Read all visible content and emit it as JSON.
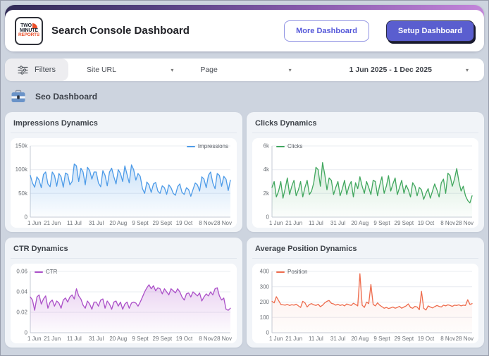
{
  "header": {
    "logo": {
      "line1": "TWO",
      "line2": "MINUTE",
      "line3": "REPORTS"
    },
    "title": "Search Console Dashboard",
    "buttons": {
      "more": "More Dashboard",
      "setup": "Setup Dashboard"
    }
  },
  "colors": {
    "accent": "#5a5ecf",
    "brand_orange": "#e94f2a",
    "header_gradient": [
      "#312b56",
      "#53407f",
      "#8a5cae",
      "#c385da"
    ]
  },
  "filter_bar": {
    "filters_label": "Filters",
    "site_url_label": "Site URL",
    "page_label": "Page",
    "date_range": "1 Jun 2025 - 1 Dec 2025",
    "caret": "▾"
  },
  "section": {
    "title": "Seo Dashboard"
  },
  "chart_data": [
    {
      "id": "impressions",
      "title": "Impressions Dynamics",
      "type": "area",
      "legend": {
        "label": "Impressions",
        "position": "right"
      },
      "color": "#4d9be8",
      "fill_opacity": 0.3,
      "ymax": 150000,
      "y_ticks": [
        {
          "v": 0,
          "label": "0"
        },
        {
          "v": 50000,
          "label": "50k"
        },
        {
          "v": 100000,
          "label": "100k"
        },
        {
          "v": 150000,
          "label": "150k"
        }
      ],
      "x_labels": [
        "1 Jun",
        "21 Jun",
        "11 Jul",
        "31 Jul",
        "20 Aug",
        "9 Sept",
        "29 Sept",
        "19 Oct",
        "8 Nov",
        "28 Nov"
      ],
      "x_label_step": 10,
      "values": [
        88000,
        72000,
        63000,
        85000,
        78000,
        62000,
        90000,
        95000,
        70000,
        64000,
        95000,
        88000,
        65000,
        92000,
        85000,
        63000,
        93000,
        90000,
        68000,
        75000,
        112000,
        108000,
        75000,
        103000,
        95000,
        68000,
        105000,
        98000,
        80000,
        95000,
        95000,
        72000,
        64000,
        98000,
        88000,
        66000,
        95000,
        103000,
        85000,
        70000,
        100000,
        92000,
        75000,
        108000,
        90000,
        72000,
        110000,
        100000,
        78000,
        92000,
        86000,
        60000,
        50000,
        74000,
        68000,
        52000,
        70000,
        73000,
        55000,
        50000,
        66000,
        62000,
        48000,
        68000,
        62000,
        50000,
        46000,
        64000,
        70000,
        52000,
        48000,
        62000,
        58000,
        44000,
        58000,
        72000,
        68000,
        55000,
        85000,
        80000,
        62000,
        88000,
        95000,
        72000,
        60000,
        92000,
        88000,
        65000,
        86000,
        80000,
        56000,
        78000
      ]
    },
    {
      "id": "clicks",
      "title": "Clicks Dynamics",
      "type": "area",
      "legend": {
        "label": "Clicks",
        "position": "left"
      },
      "color": "#41a75e",
      "fill_opacity": 0.22,
      "ymax": 6000,
      "y_ticks": [
        {
          "v": 0,
          "label": "0"
        },
        {
          "v": 2000,
          "label": "2k"
        },
        {
          "v": 4000,
          "label": "4k"
        },
        {
          "v": 6000,
          "label": "6k"
        }
      ],
      "x_labels": [
        "1 Jun",
        "21 Jun",
        "11 Jul",
        "31 Jul",
        "20 Aug",
        "9 Sept",
        "29 Sept",
        "19 Oct",
        "8 Nov",
        "28 Nov"
      ],
      "x_label_step": 10,
      "values": [
        2500,
        3000,
        1700,
        2200,
        3000,
        1600,
        2400,
        3300,
        1900,
        2600,
        3100,
        1800,
        2300,
        3000,
        1700,
        2500,
        3100,
        1900,
        2200,
        2900,
        4200,
        4000,
        2600,
        4600,
        3600,
        2300,
        3300,
        3100,
        1900,
        2500,
        3000,
        1800,
        2400,
        3100,
        1900,
        2600,
        3000,
        1700,
        2900,
        2400,
        3400,
        2600,
        2000,
        3000,
        2500,
        1900,
        3100,
        3000,
        1800,
        2700,
        3400,
        2000,
        2600,
        3500,
        2200,
        2800,
        3300,
        1900,
        2500,
        3100,
        2000,
        2700,
        2300,
        1700,
        2900,
        2600,
        1800,
        2500,
        2300,
        1500,
        2000,
        2400,
        1600,
        2200,
        2800,
        2300,
        1700,
        2900,
        3200,
        2000,
        3700,
        3500,
        2600,
        3200,
        4100,
        3000,
        2200,
        2600,
        1800,
        1400,
        1200,
        1800
      ]
    },
    {
      "id": "ctr",
      "title": "CTR Dynamics",
      "type": "area",
      "legend": {
        "label": "CTR",
        "position": "left"
      },
      "color": "#ab4fc8",
      "fill_opacity": 0.25,
      "ymax": 0.06,
      "y_ticks": [
        {
          "v": 0,
          "label": "0"
        },
        {
          "v": 0.02,
          "label": "0.02"
        },
        {
          "v": 0.04,
          "label": "0.04"
        },
        {
          "v": 0.06,
          "label": "0.06"
        }
      ],
      "x_labels": [
        "1 Jun",
        "21 Jun",
        "11 Jul",
        "31 Jul",
        "20 Aug",
        "9 Sept",
        "29 Sept",
        "19 Oct",
        "8 Nov",
        "28 Nov"
      ],
      "x_label_step": 10,
      "values": [
        0.035,
        0.032,
        0.022,
        0.035,
        0.037,
        0.028,
        0.033,
        0.036,
        0.024,
        0.03,
        0.032,
        0.026,
        0.031,
        0.029,
        0.024,
        0.032,
        0.034,
        0.03,
        0.035,
        0.037,
        0.033,
        0.043,
        0.036,
        0.033,
        0.027,
        0.024,
        0.031,
        0.028,
        0.023,
        0.03,
        0.03,
        0.026,
        0.032,
        0.033,
        0.024,
        0.031,
        0.028,
        0.023,
        0.03,
        0.031,
        0.026,
        0.03,
        0.023,
        0.028,
        0.03,
        0.024,
        0.029,
        0.03,
        0.029,
        0.026,
        0.03,
        0.035,
        0.04,
        0.044,
        0.047,
        0.043,
        0.046,
        0.041,
        0.044,
        0.043,
        0.038,
        0.043,
        0.04,
        0.037,
        0.043,
        0.041,
        0.039,
        0.043,
        0.04,
        0.035,
        0.032,
        0.038,
        0.039,
        0.035,
        0.04,
        0.038,
        0.036,
        0.039,
        0.031,
        0.035,
        0.038,
        0.036,
        0.04,
        0.037,
        0.043,
        0.044,
        0.036,
        0.032,
        0.034,
        0.023,
        0.022,
        0.024
      ]
    },
    {
      "id": "position",
      "title": "Average Position Dynamics",
      "type": "area",
      "legend": {
        "label": "Position",
        "position": "left"
      },
      "color": "#ee6c4d",
      "fill_opacity": 0.12,
      "ymax": 400,
      "y_ticks": [
        {
          "v": 0,
          "label": "0"
        },
        {
          "v": 100,
          "label": "100"
        },
        {
          "v": 200,
          "label": "200"
        },
        {
          "v": 300,
          "label": "300"
        },
        {
          "v": 400,
          "label": "400"
        }
      ],
      "x_labels": [
        "1 Jun",
        "21 Jun",
        "11 Jul",
        "31 Jul",
        "20 Aug",
        "9 Sept",
        "29 Sept",
        "19 Oct",
        "8 Nov",
        "28 Nov"
      ],
      "x_label_step": 10,
      "values": [
        205,
        195,
        235,
        210,
        185,
        182,
        180,
        185,
        178,
        183,
        180,
        186,
        175,
        165,
        205,
        195,
        168,
        185,
        190,
        182,
        178,
        186,
        170,
        180,
        195,
        205,
        210,
        192,
        188,
        180,
        186,
        178,
        183,
        175,
        188,
        182,
        178,
        192,
        185,
        175,
        385,
        180,
        165,
        200,
        190,
        315,
        185,
        175,
        195,
        180,
        170,
        160,
        165,
        158,
        162,
        168,
        160,
        165,
        172,
        160,
        168,
        175,
        188,
        165,
        160,
        172,
        168,
        150,
        270,
        160,
        148,
        175,
        168,
        162,
        170,
        178,
        172,
        168,
        180,
        175,
        182,
        178,
        172,
        180,
        178,
        182,
        175,
        180,
        178,
        215,
        185,
        190
      ]
    }
  ]
}
